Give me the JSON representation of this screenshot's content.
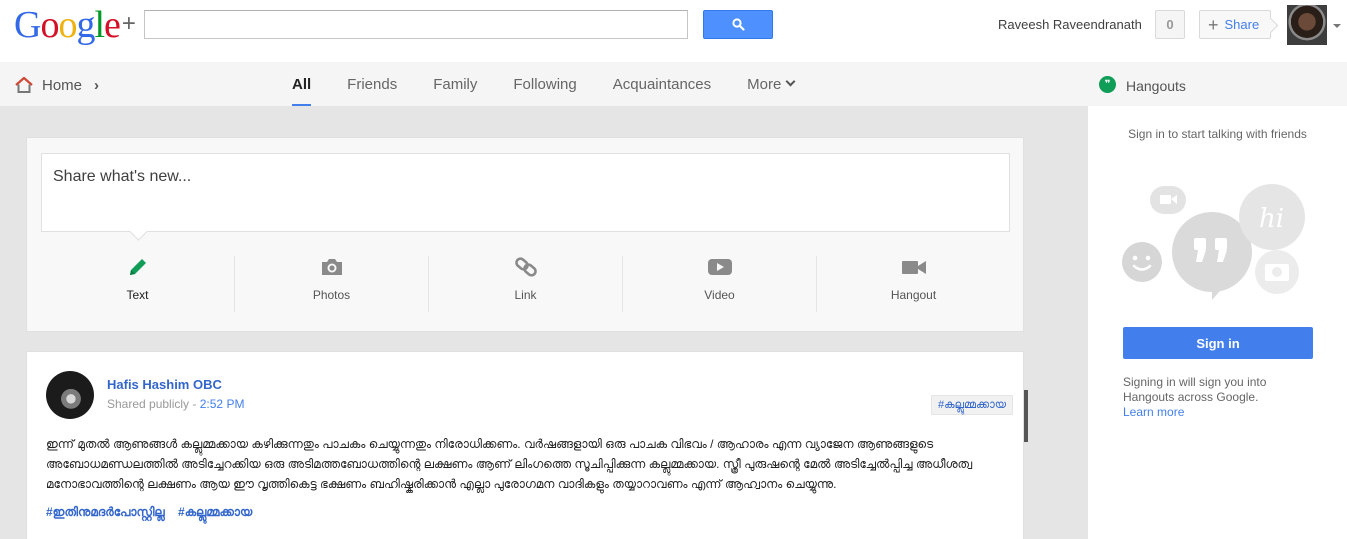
{
  "app": {
    "logo_text": "Google",
    "logo_plus": "+"
  },
  "header": {
    "search_value": "",
    "search_placeholder": "",
    "user_name": "Raveesh Raveendranath",
    "notification_count": "0",
    "share_label": "Share"
  },
  "nav": {
    "home_label": "Home",
    "tabs": [
      {
        "label": "All",
        "active": true
      },
      {
        "label": "Friends",
        "active": false
      },
      {
        "label": "Family",
        "active": false
      },
      {
        "label": "Following",
        "active": false
      },
      {
        "label": "Acquaintances",
        "active": false
      },
      {
        "label": "More",
        "active": false
      }
    ]
  },
  "hangouts": {
    "title": "Hangouts",
    "subtitle": "Sign in to start talking with friends",
    "art_text": "hi",
    "signin_label": "Sign in",
    "signin_note": "Signing in will sign you into Hangouts across Google.",
    "learn_more": "Learn more"
  },
  "sharebox": {
    "placeholder": "Share what's new...",
    "actions": [
      {
        "label": "Text",
        "icon": "pencil-icon"
      },
      {
        "label": "Photos",
        "icon": "camera-icon"
      },
      {
        "label": "Link",
        "icon": "link-icon"
      },
      {
        "label": "Video",
        "icon": "video-play-icon"
      },
      {
        "label": "Hangout",
        "icon": "video-camera-icon"
      }
    ]
  },
  "post": {
    "author": "Hafis Hashim OBC",
    "visibility": "Shared publicly",
    "separator": "-",
    "time": "2:52 PM",
    "tag": "#കല്ലുമ്മക്കായ",
    "body": "ഇന്ന് മുതൽ ആണുങ്ങൾ കല്ലുമ്മക്കായ കഴിക്കുന്നതും പാചകം ചെയ്യുന്നതും നിരോധിക്കണം. വർഷങ്ങളായി ഒരു പാചക വിഭവം / ആഹാരം എന്ന വ്യാജേന ആണുങ്ങളുടെ അബോധമണ്ഡലത്തിൽ അടിച്ചേറക്കിയ ഒരു അടിമത്തബോധത്തിന്റെ ലക്ഷണം ആണ് ലിംഗത്തെ സൂചിപ്പിക്കുന്ന കല്ലുമ്മക്കായ. സ്ത്രീ പുരുഷന്റെ മേൽ അടിച്ചേൽപ്പിച്ച അധീശത്വ മനോഭാവത്തിന്റെ ലക്ഷണം ആയ ഈ വൃത്തികെട്ട ഭക്ഷണം ബഹിഷ്കരിക്കാൻ എല്ലാ പുരോഗമന വാദികളും തയ്യാറാവണം എന്ന് ആഹ്വാനം ചെയ്യുന്നു.",
    "hashtags": [
      "#ഇതിനുമദർപോസ്റ്റില്ല",
      "#കല്ലുമ്മക്കായ"
    ]
  },
  "colors": {
    "accent": "#427fed",
    "link": "#3366cc",
    "hangouts_green": "#0f9d58"
  }
}
